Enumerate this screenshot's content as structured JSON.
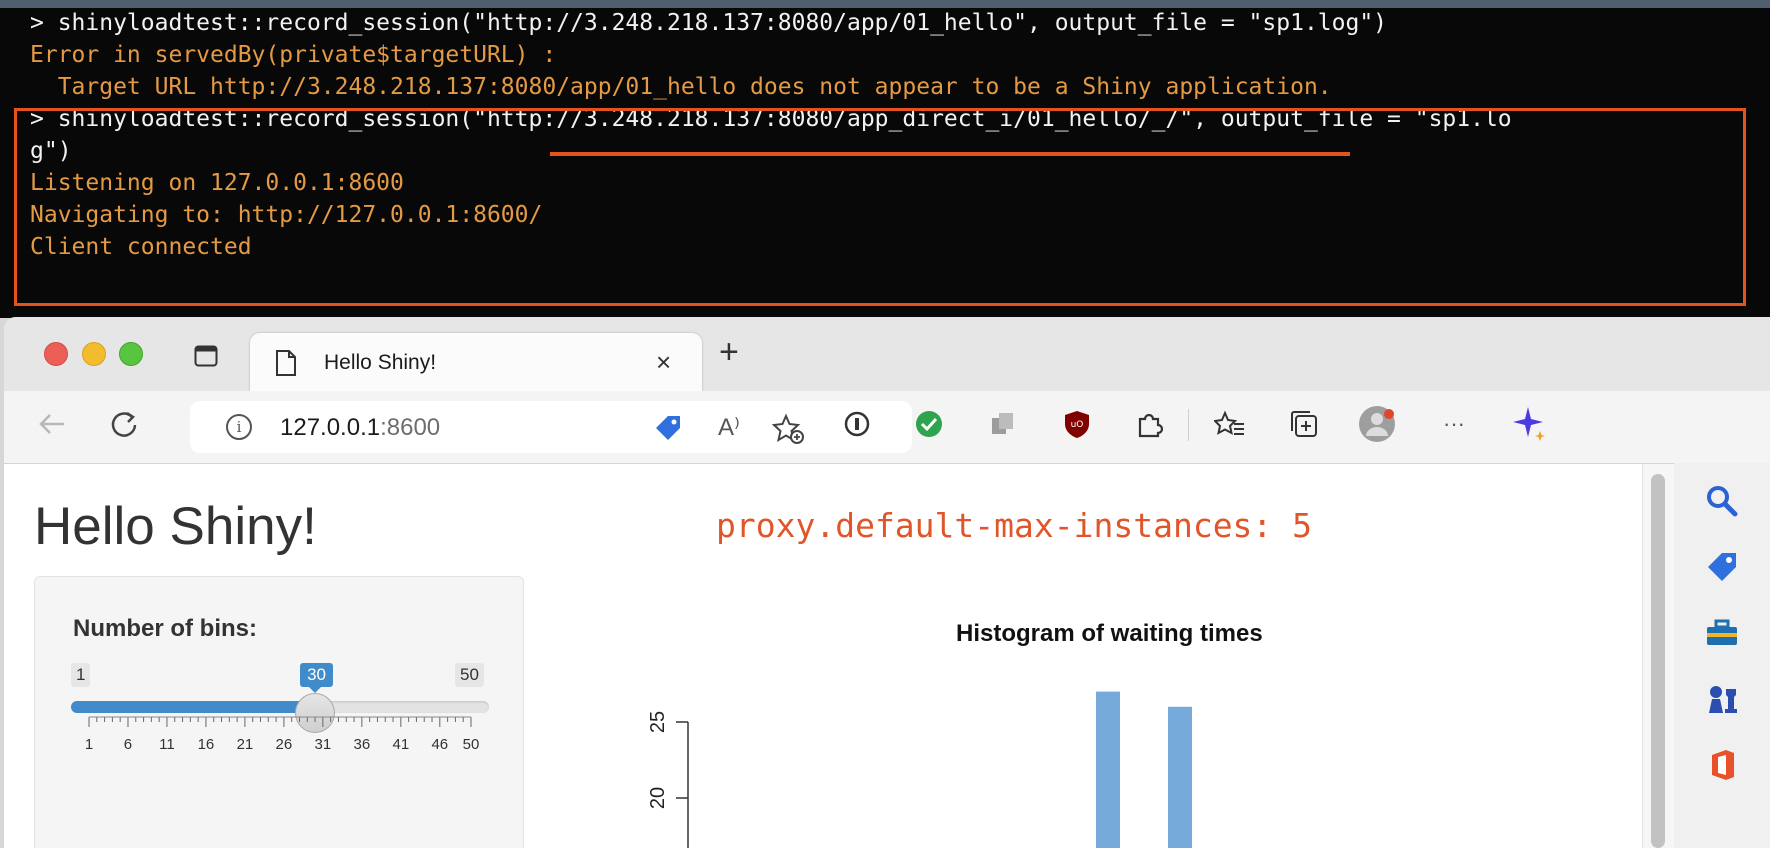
{
  "terminal": {
    "lines": [
      "> shinyloadtest::record_session(\"http://3.248.218.137:8080/app/01_hello\", output_file = \"sp1.log\")",
      "Error in servedBy(private$targetURL) :",
      "  Target URL http://3.248.218.137:8080/app/01_hello does not appear to be a Shiny application.",
      "> shinyloadtest::record_session(\"http://3.248.218.137:8080/app_direct_i/01_hello/_/\", output_file = \"sp1.lo",
      "g\")",
      "Listening on 127.0.0.1:8600",
      "Navigating to: http://127.0.0.1:8600/",
      "Client connected"
    ],
    "highlight_color": "#e5531c"
  },
  "browser": {
    "tab_title": "Hello Shiny!",
    "tab_close": "×",
    "new_tab": "+",
    "address_host": "127.0.0.1",
    "address_port": ":8600",
    "toolbar_icons": [
      "back-icon",
      "refresh-icon",
      "site-info-icon",
      "tag-icon",
      "read-aloud-icon",
      "add-favorite-icon",
      "password-manager-icon",
      "check-extension-icon",
      "copy-extension-icon",
      "ublock-icon",
      "extensions-icon",
      "favorites-icon",
      "collections-icon",
      "profile-icon",
      "more-icon",
      "copilot-icon"
    ],
    "more_label": "···",
    "sidebar_icons": [
      "search-icon",
      "tag-icon",
      "toolbox-icon",
      "games-icon",
      "office-icon"
    ]
  },
  "app": {
    "title": "Hello Shiny!",
    "proxy_note": "proxy.default-max-instances: 5",
    "slider": {
      "label": "Number of bins:",
      "min": 1,
      "max": 50,
      "value": 30,
      "min_label": "1",
      "max_label": "50",
      "value_label": "30",
      "tick_labels": [
        "1",
        "6",
        "11",
        "16",
        "21",
        "26",
        "31",
        "36",
        "41",
        "46",
        "50"
      ],
      "accent": "#428bca"
    }
  },
  "chart_data": {
    "type": "bar",
    "title": "Histogram of waiting times",
    "y_tick_labels": [
      "25",
      "20"
    ],
    "visible_bars": [
      {
        "y": 27
      },
      {
        "y": 26
      }
    ],
    "bar_color": "#75aadb"
  }
}
